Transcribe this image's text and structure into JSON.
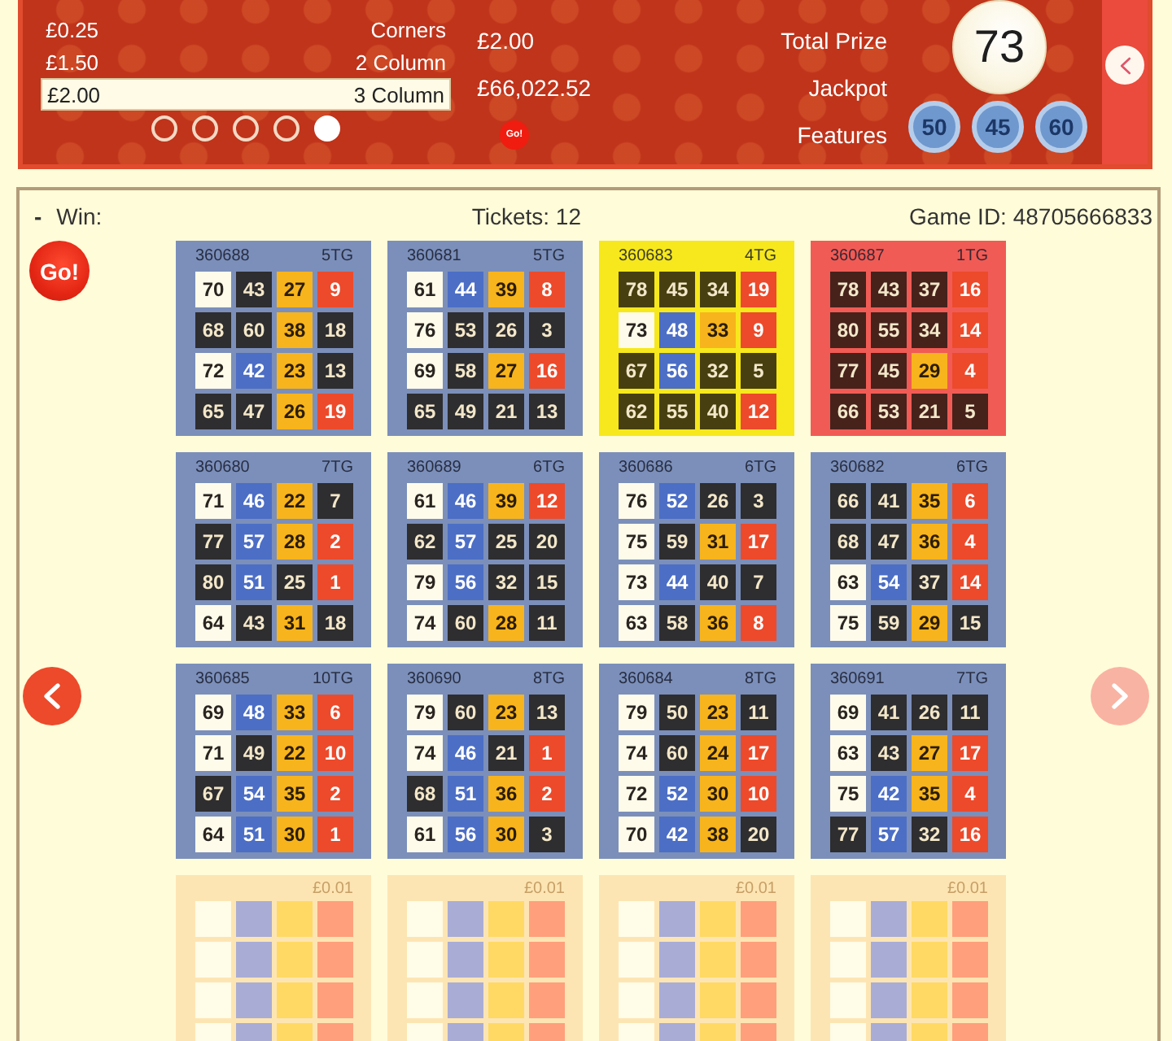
{
  "header": {
    "prizes": {
      "items": [
        {
          "amount": "£0.25",
          "name": "Corners",
          "selected": false
        },
        {
          "amount": "£1.50",
          "name": "2 Column",
          "selected": false
        },
        {
          "amount": "£2.00",
          "name": "3 Column",
          "selected": true
        }
      ],
      "pages": [
        {
          "selected": false
        },
        {
          "selected": false
        },
        {
          "selected": false
        },
        {
          "selected": false
        },
        {
          "selected": true
        }
      ]
    },
    "info": [
      {
        "value": "£2.00",
        "label": "Total Prize",
        "kind": "text"
      },
      {
        "value": "£66,022.52",
        "label": "Jackpot",
        "kind": "text"
      },
      {
        "value": "Go!",
        "label": "Features",
        "kind": "badge"
      }
    ],
    "current_ball": "73",
    "previous_balls": [
      "50",
      "45",
      "60"
    ]
  },
  "game": {
    "win_value": "-",
    "win_label": "Win:",
    "ticket_count": "Tickets: 12",
    "game_id": "Game ID: 48705666833",
    "go": "Go!",
    "pager": {
      "left": {
        "disabled": false
      },
      "right": {
        "disabled": true
      }
    },
    "tickets": [
      {
        "id": "360688",
        "to_go": "5TG",
        "color": "#7b8fba",
        "cells": [
          [
            {
              "number": "70",
              "daubed": false
            },
            {
              "number": "43",
              "daubed": true
            },
            {
              "number": "27",
              "daubed": false
            },
            {
              "number": "9",
              "daubed": false
            }
          ],
          [
            {
              "number": "68",
              "daubed": true
            },
            {
              "number": "60",
              "daubed": true
            },
            {
              "number": "38",
              "daubed": false
            },
            {
              "number": "18",
              "daubed": true
            }
          ],
          [
            {
              "number": "72",
              "daubed": false
            },
            {
              "number": "42",
              "daubed": false
            },
            {
              "number": "23",
              "daubed": false
            },
            {
              "number": "13",
              "daubed": true
            }
          ],
          [
            {
              "number": "65",
              "daubed": true
            },
            {
              "number": "47",
              "daubed": true
            },
            {
              "number": "26",
              "daubed": false
            },
            {
              "number": "19",
              "daubed": false
            }
          ]
        ]
      },
      {
        "id": "360681",
        "to_go": "5TG",
        "color": "#7b8fba",
        "cells": [
          [
            {
              "number": "61",
              "daubed": false
            },
            {
              "number": "44",
              "daubed": false
            },
            {
              "number": "39",
              "daubed": false
            },
            {
              "number": "8",
              "daubed": false
            }
          ],
          [
            {
              "number": "76",
              "daubed": false
            },
            {
              "number": "53",
              "daubed": true
            },
            {
              "number": "26",
              "daubed": true
            },
            {
              "number": "3",
              "daubed": true
            }
          ],
          [
            {
              "number": "69",
              "daubed": false
            },
            {
              "number": "58",
              "daubed": true
            },
            {
              "number": "27",
              "daubed": false
            },
            {
              "number": "16",
              "daubed": false
            }
          ],
          [
            {
              "number": "65",
              "daubed": true
            },
            {
              "number": "49",
              "daubed": true
            },
            {
              "number": "21",
              "daubed": true
            },
            {
              "number": "13",
              "daubed": true
            }
          ]
        ]
      },
      {
        "id": "360683",
        "to_go": "4TG",
        "color": "#f6e81c",
        "cells": [
          [
            {
              "number": "78",
              "daubed": true
            },
            {
              "number": "45",
              "daubed": true
            },
            {
              "number": "34",
              "daubed": true
            },
            {
              "number": "19",
              "daubed": false
            }
          ],
          [
            {
              "number": "73",
              "daubed": false
            },
            {
              "number": "48",
              "daubed": false
            },
            {
              "number": "33",
              "daubed": false
            },
            {
              "number": "9",
              "daubed": false
            }
          ],
          [
            {
              "number": "67",
              "daubed": true
            },
            {
              "number": "56",
              "daubed": false
            },
            {
              "number": "32",
              "daubed": true
            },
            {
              "number": "5",
              "daubed": true
            }
          ],
          [
            {
              "number": "62",
              "daubed": true
            },
            {
              "number": "55",
              "daubed": true
            },
            {
              "number": "40",
              "daubed": true
            },
            {
              "number": "12",
              "daubed": false
            }
          ]
        ]
      },
      {
        "id": "360687",
        "to_go": "1TG",
        "color": "#f15b55",
        "cells": [
          [
            {
              "number": "78",
              "daubed": true
            },
            {
              "number": "43",
              "daubed": true
            },
            {
              "number": "37",
              "daubed": true
            },
            {
              "number": "16",
              "daubed": false
            }
          ],
          [
            {
              "number": "80",
              "daubed": true
            },
            {
              "number": "55",
              "daubed": true
            },
            {
              "number": "34",
              "daubed": true
            },
            {
              "number": "14",
              "daubed": false
            }
          ],
          [
            {
              "number": "77",
              "daubed": true
            },
            {
              "number": "45",
              "daubed": true
            },
            {
              "number": "29",
              "daubed": false
            },
            {
              "number": "4",
              "daubed": false
            }
          ],
          [
            {
              "number": "66",
              "daubed": true
            },
            {
              "number": "53",
              "daubed": true
            },
            {
              "number": "21",
              "daubed": true
            },
            {
              "number": "5",
              "daubed": true
            }
          ]
        ]
      },
      {
        "id": "360680",
        "to_go": "7TG",
        "color": "#7b8fba",
        "cells": [
          [
            {
              "number": "71",
              "daubed": false
            },
            {
              "number": "46",
              "daubed": false
            },
            {
              "number": "22",
              "daubed": false
            },
            {
              "number": "7",
              "daubed": true
            }
          ],
          [
            {
              "number": "77",
              "daubed": true
            },
            {
              "number": "57",
              "daubed": false
            },
            {
              "number": "28",
              "daubed": false
            },
            {
              "number": "2",
              "daubed": false
            }
          ],
          [
            {
              "number": "80",
              "daubed": true
            },
            {
              "number": "51",
              "daubed": false
            },
            {
              "number": "25",
              "daubed": true
            },
            {
              "number": "1",
              "daubed": false
            }
          ],
          [
            {
              "number": "64",
              "daubed": false
            },
            {
              "number": "43",
              "daubed": true
            },
            {
              "number": "31",
              "daubed": false
            },
            {
              "number": "18",
              "daubed": true
            }
          ]
        ]
      },
      {
        "id": "360689",
        "to_go": "6TG",
        "color": "#7b8fba",
        "cells": [
          [
            {
              "number": "61",
              "daubed": false
            },
            {
              "number": "46",
              "daubed": false
            },
            {
              "number": "39",
              "daubed": false
            },
            {
              "number": "12",
              "daubed": false
            }
          ],
          [
            {
              "number": "62",
              "daubed": true
            },
            {
              "number": "57",
              "daubed": false
            },
            {
              "number": "25",
              "daubed": true
            },
            {
              "number": "20",
              "daubed": true
            }
          ],
          [
            {
              "number": "79",
              "daubed": false
            },
            {
              "number": "56",
              "daubed": false
            },
            {
              "number": "32",
              "daubed": true
            },
            {
              "number": "15",
              "daubed": true
            }
          ],
          [
            {
              "number": "74",
              "daubed": false
            },
            {
              "number": "60",
              "daubed": true
            },
            {
              "number": "28",
              "daubed": false
            },
            {
              "number": "11",
              "daubed": true
            }
          ]
        ]
      },
      {
        "id": "360686",
        "to_go": "6TG",
        "color": "#7b8fba",
        "cells": [
          [
            {
              "number": "76",
              "daubed": false
            },
            {
              "number": "52",
              "daubed": false
            },
            {
              "number": "26",
              "daubed": true
            },
            {
              "number": "3",
              "daubed": true
            }
          ],
          [
            {
              "number": "75",
              "daubed": false
            },
            {
              "number": "59",
              "daubed": true
            },
            {
              "number": "31",
              "daubed": false
            },
            {
              "number": "17",
              "daubed": false
            }
          ],
          [
            {
              "number": "73",
              "daubed": false
            },
            {
              "number": "44",
              "daubed": false
            },
            {
              "number": "40",
              "daubed": true
            },
            {
              "number": "7",
              "daubed": true
            }
          ],
          [
            {
              "number": "63",
              "daubed": false
            },
            {
              "number": "58",
              "daubed": true
            },
            {
              "number": "36",
              "daubed": false
            },
            {
              "number": "8",
              "daubed": false
            }
          ]
        ]
      },
      {
        "id": "360682",
        "to_go": "6TG",
        "color": "#7b8fba",
        "cells": [
          [
            {
              "number": "66",
              "daubed": true
            },
            {
              "number": "41",
              "daubed": true
            },
            {
              "number": "35",
              "daubed": false
            },
            {
              "number": "6",
              "daubed": false
            }
          ],
          [
            {
              "number": "68",
              "daubed": true
            },
            {
              "number": "47",
              "daubed": true
            },
            {
              "number": "36",
              "daubed": false
            },
            {
              "number": "4",
              "daubed": false
            }
          ],
          [
            {
              "number": "63",
              "daubed": false
            },
            {
              "number": "54",
              "daubed": false
            },
            {
              "number": "37",
              "daubed": true
            },
            {
              "number": "14",
              "daubed": false
            }
          ],
          [
            {
              "number": "75",
              "daubed": false
            },
            {
              "number": "59",
              "daubed": true
            },
            {
              "number": "29",
              "daubed": false
            },
            {
              "number": "15",
              "daubed": true
            }
          ]
        ]
      },
      {
        "id": "360685",
        "to_go": "10TG",
        "color": "#7b8fba",
        "cells": [
          [
            {
              "number": "69",
              "daubed": false
            },
            {
              "number": "48",
              "daubed": false
            },
            {
              "number": "33",
              "daubed": false
            },
            {
              "number": "6",
              "daubed": false
            }
          ],
          [
            {
              "number": "71",
              "daubed": false
            },
            {
              "number": "49",
              "daubed": true
            },
            {
              "number": "22",
              "daubed": false
            },
            {
              "number": "10",
              "daubed": false
            }
          ],
          [
            {
              "number": "67",
              "daubed": true
            },
            {
              "number": "54",
              "daubed": false
            },
            {
              "number": "35",
              "daubed": false
            },
            {
              "number": "2",
              "daubed": false
            }
          ],
          [
            {
              "number": "64",
              "daubed": false
            },
            {
              "number": "51",
              "daubed": false
            },
            {
              "number": "30",
              "daubed": false
            },
            {
              "number": "1",
              "daubed": false
            }
          ]
        ]
      },
      {
        "id": "360690",
        "to_go": "8TG",
        "color": "#7b8fba",
        "cells": [
          [
            {
              "number": "79",
              "daubed": false
            },
            {
              "number": "60",
              "daubed": true
            },
            {
              "number": "23",
              "daubed": false
            },
            {
              "number": "13",
              "daubed": true
            }
          ],
          [
            {
              "number": "74",
              "daubed": false
            },
            {
              "number": "46",
              "daubed": false
            },
            {
              "number": "21",
              "daubed": true
            },
            {
              "number": "1",
              "daubed": false
            }
          ],
          [
            {
              "number": "68",
              "daubed": true
            },
            {
              "number": "51",
              "daubed": false
            },
            {
              "number": "36",
              "daubed": false
            },
            {
              "number": "2",
              "daubed": false
            }
          ],
          [
            {
              "number": "61",
              "daubed": false
            },
            {
              "number": "56",
              "daubed": false
            },
            {
              "number": "30",
              "daubed": false
            },
            {
              "number": "3",
              "daubed": true
            }
          ]
        ]
      },
      {
        "id": "360684",
        "to_go": "8TG",
        "color": "#7b8fba",
        "cells": [
          [
            {
              "number": "79",
              "daubed": false
            },
            {
              "number": "50",
              "daubed": true
            },
            {
              "number": "23",
              "daubed": false
            },
            {
              "number": "11",
              "daubed": true
            }
          ],
          [
            {
              "number": "74",
              "daubed": false
            },
            {
              "number": "60",
              "daubed": true
            },
            {
              "number": "24",
              "daubed": false
            },
            {
              "number": "17",
              "daubed": false
            }
          ],
          [
            {
              "number": "72",
              "daubed": false
            },
            {
              "number": "52",
              "daubed": false
            },
            {
              "number": "30",
              "daubed": false
            },
            {
              "number": "10",
              "daubed": false
            }
          ],
          [
            {
              "number": "70",
              "daubed": false
            },
            {
              "number": "42",
              "daubed": false
            },
            {
              "number": "38",
              "daubed": false
            },
            {
              "number": "20",
              "daubed": true
            }
          ]
        ]
      },
      {
        "id": "360691",
        "to_go": "7TG",
        "color": "#7b8fba",
        "cells": [
          [
            {
              "number": "69",
              "daubed": false
            },
            {
              "number": "41",
              "daubed": true
            },
            {
              "number": "26",
              "daubed": true
            },
            {
              "number": "11",
              "daubed": true
            }
          ],
          [
            {
              "number": "63",
              "daubed": false
            },
            {
              "number": "43",
              "daubed": true
            },
            {
              "number": "27",
              "daubed": false
            },
            {
              "number": "17",
              "daubed": false
            }
          ],
          [
            {
              "number": "75",
              "daubed": false
            },
            {
              "number": "42",
              "daubed": false
            },
            {
              "number": "35",
              "daubed": false
            },
            {
              "number": "4",
              "daubed": false
            }
          ],
          [
            {
              "number": "77",
              "daubed": true
            },
            {
              "number": "57",
              "daubed": false
            },
            {
              "number": "32",
              "daubed": true
            },
            {
              "number": "16",
              "daubed": false
            }
          ]
        ]
      }
    ],
    "available_tickets": [
      {
        "price": "£0.01"
      },
      {
        "price": "£0.01"
      },
      {
        "price": "£0.01"
      },
      {
        "price": "£0.01"
      }
    ]
  }
}
